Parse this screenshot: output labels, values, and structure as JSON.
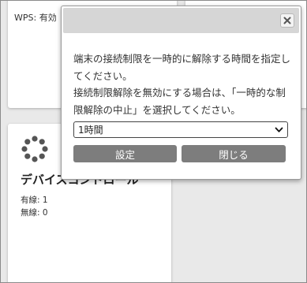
{
  "background": {
    "wps_status": "WPS: 有効",
    "device_control_title": "デバイスコントロール",
    "wired_label": "有線: 1",
    "wireless_label": "無線: 0"
  },
  "dialog": {
    "message_line1": "端末の接続制限を一時的に解除する時間を指定してください。",
    "message_line2": "接続制限解除を無効にする場合は、「一時的な制限解除の中止」を選択してください。",
    "duration_select": {
      "selected": "1時間"
    },
    "set_button_label": "設定",
    "close_button_label": "閉じる"
  },
  "colors": {
    "button_bg": "#7d7d7d",
    "titlebar_bg": "#d6d6d6",
    "page_bg": "#e9e9e9"
  },
  "icons": {
    "close": "close-x-icon",
    "device_control": "gear-dots-icon",
    "select_arrow": "chevron-down-icon"
  }
}
